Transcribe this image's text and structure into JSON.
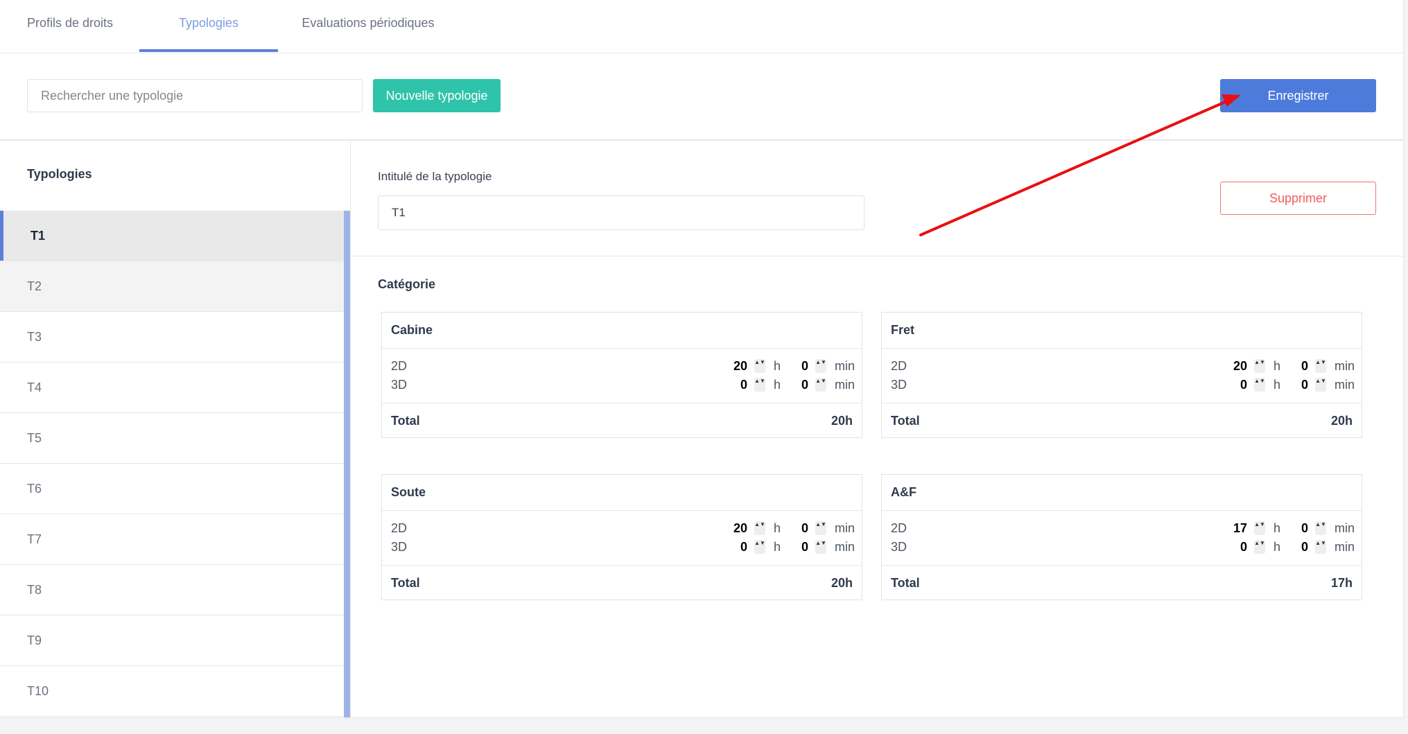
{
  "tabs": [
    {
      "label": "Profils de droits"
    },
    {
      "label": "Typologies"
    },
    {
      "label": "Evaluations périodiques"
    }
  ],
  "toolbar": {
    "search_placeholder": "Rechercher une typologie",
    "new_label": "Nouvelle typologie",
    "save_label": "Enregistrer"
  },
  "sidebar": {
    "title": "Typologies",
    "items": [
      {
        "label": "T1"
      },
      {
        "label": "T2"
      },
      {
        "label": "T3"
      },
      {
        "label": "T4"
      },
      {
        "label": "T5"
      },
      {
        "label": "T6"
      },
      {
        "label": "T7"
      },
      {
        "label": "T8"
      },
      {
        "label": "T9"
      },
      {
        "label": "T10"
      }
    ]
  },
  "form": {
    "field_label": "Intitulé de la typologie",
    "field_value": "T1",
    "delete_label": "Supprimer",
    "category_title": "Catégorie"
  },
  "units": {
    "hours": "h",
    "minutes": "min"
  },
  "spinner_glyph": "▲▼",
  "cards": [
    {
      "title": "Cabine",
      "rows": [
        {
          "label": "2D",
          "hours": "20",
          "minutes": "0"
        },
        {
          "label": "3D",
          "hours": "0",
          "minutes": "0"
        }
      ],
      "total_label": "Total",
      "total_value": "20h"
    },
    {
      "title": "Fret",
      "rows": [
        {
          "label": "2D",
          "hours": "20",
          "minutes": "0"
        },
        {
          "label": "3D",
          "hours": "0",
          "minutes": "0"
        }
      ],
      "total_label": "Total",
      "total_value": "20h"
    },
    {
      "title": "Soute",
      "rows": [
        {
          "label": "2D",
          "hours": "20",
          "minutes": "0"
        },
        {
          "label": "3D",
          "hours": "0",
          "minutes": "0"
        }
      ],
      "total_label": "Total",
      "total_value": "20h"
    },
    {
      "title": "A&F",
      "rows": [
        {
          "label": "2D",
          "hours": "17",
          "minutes": "0"
        },
        {
          "label": "3D",
          "hours": "0",
          "minutes": "0"
        }
      ],
      "total_label": "Total",
      "total_value": "17h"
    }
  ],
  "colors": {
    "accent": "#5b7fdb",
    "save_button": "#4d7bdb",
    "new_button": "#2ec3aa",
    "delete": "#f05b5b",
    "annotation_arrow": "#e81010"
  }
}
